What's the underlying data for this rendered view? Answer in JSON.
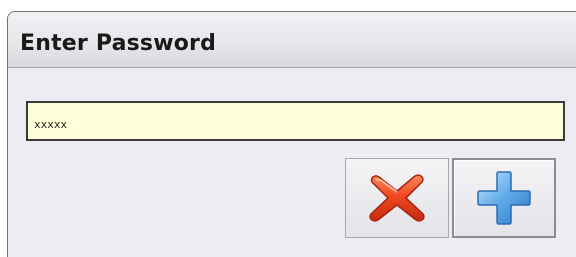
{
  "window": {
    "title": "Enter Password"
  },
  "password": {
    "value": "xxxxx"
  },
  "buttons": {
    "cancel_icon": "red-x-icon",
    "add_icon": "blue-plus-icon"
  },
  "colors": {
    "field_background": "#fffed8",
    "cancel_red": "#e8391a",
    "add_blue": "#4a9de0"
  }
}
